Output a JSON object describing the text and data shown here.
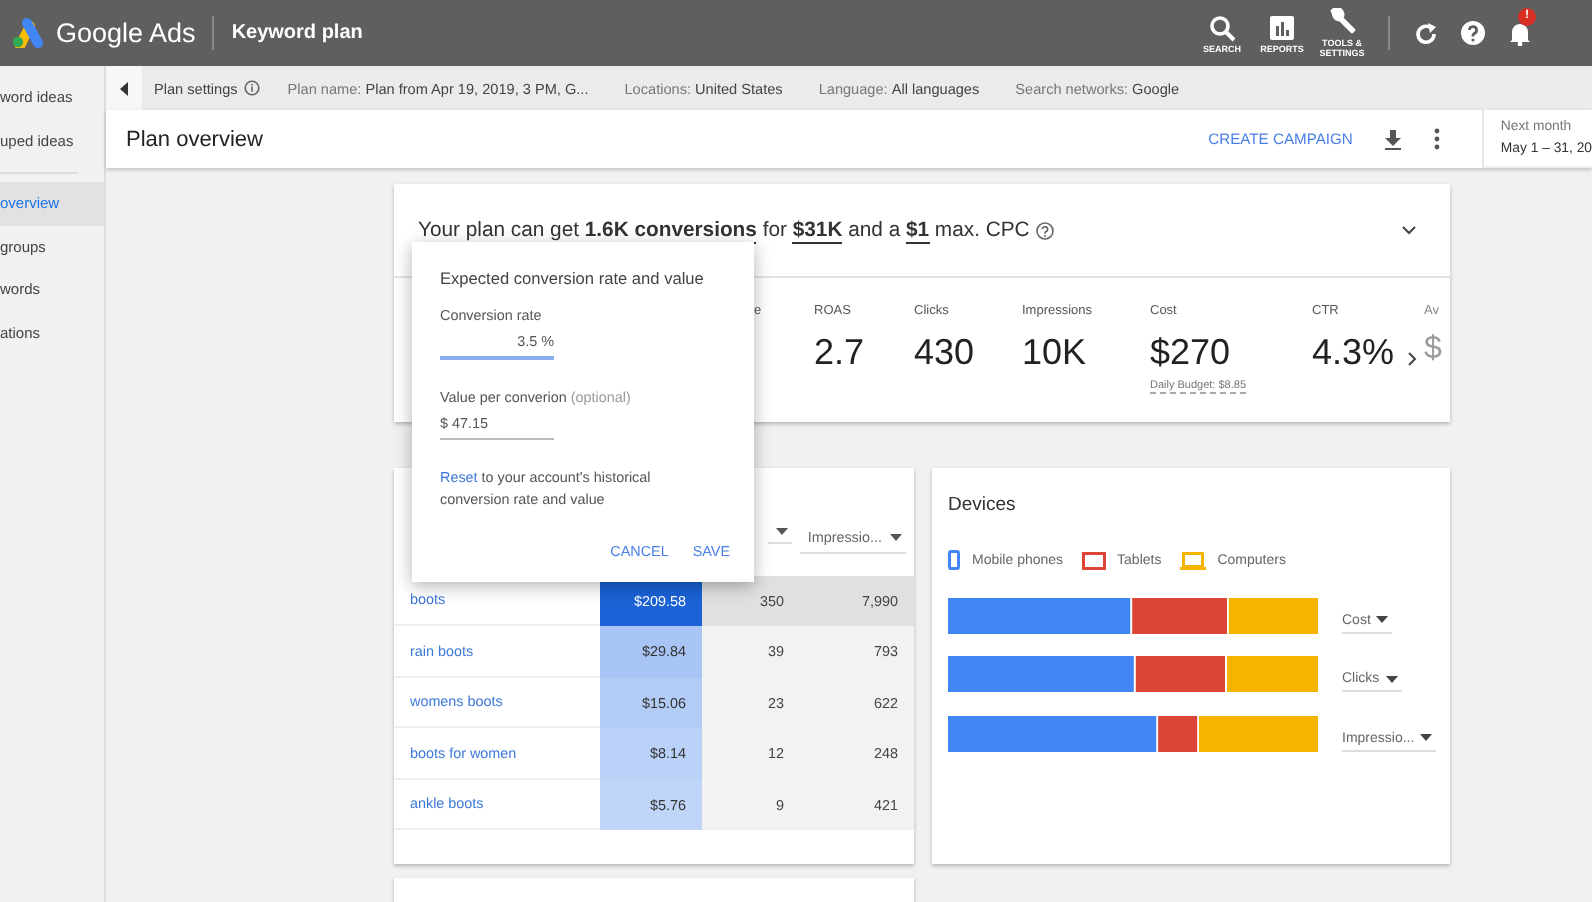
{
  "app_bar": {
    "product": "Google Ads",
    "page_title": "Keyword plan",
    "tools": [
      {
        "kind": "search",
        "label": "SEARCH"
      },
      {
        "kind": "reports",
        "label": "REPORTS"
      },
      {
        "kind": "tools",
        "label": "TOOLS &\nSETTINGS"
      }
    ],
    "notification_badge": "!"
  },
  "sidebar": {
    "sections": [
      {
        "items": [
          {
            "label": "word ideas",
            "selected": false
          },
          {
            "label": "uped ideas",
            "selected": false
          }
        ]
      },
      {
        "items": [
          {
            "label": "overview",
            "selected": true
          },
          {
            "label": "groups",
            "selected": false
          },
          {
            "label": "words",
            "selected": false
          },
          {
            "label": "ations",
            "selected": false
          }
        ]
      }
    ]
  },
  "plan_settings": {
    "title": "Plan settings",
    "items": [
      {
        "label": "Plan name:",
        "value": "Plan from Apr 19, 2019, 3 PM, G..."
      },
      {
        "label": "Locations:",
        "value": "United States"
      },
      {
        "label": "Language:",
        "value": "All languages"
      },
      {
        "label": "Search networks:",
        "value": "Google"
      }
    ]
  },
  "header": {
    "title": "Plan overview",
    "action": "CREATE CAMPAIGN",
    "date_label": "Next month",
    "date_range": "May 1 – 31, 20"
  },
  "summary": {
    "headline": "Your plan can get **1.6K conversions** for **$31K** and a **$1** max. CPC",
    "metrics": [
      {
        "label": "e",
        "faded": false
      },
      {
        "label": "ROAS",
        "value": "2.7",
        "faded": false
      },
      {
        "label": "Clicks",
        "value": "430",
        "faded": false
      },
      {
        "label": "Impressions",
        "value": "10K",
        "faded": false
      },
      {
        "label": "Cost",
        "value": "$270",
        "note": "Daily Budget: $8.85",
        "faded": false
      },
      {
        "label": "CTR",
        "value": "4.3%",
        "faded": false
      },
      {
        "label": "Av",
        "value": "$",
        "faded": true
      }
    ]
  },
  "conversion_popup": {
    "title": "Expected conversion rate and value",
    "fields": [
      {
        "label": "Conversion rate",
        "value": "3.5 %",
        "focused": true
      },
      {
        "label": "Value per converion",
        "hint": "(optional)",
        "value": "$ 47.15",
        "focused": false
      }
    ],
    "reset_link": "Reset",
    "reset_text": "to your account's historical conversion rate and value",
    "buttons": [
      "CANCEL",
      "SAVE"
    ]
  },
  "keywords": {
    "header": [
      {
        "kind": "caret"
      },
      {
        "kind": "labeled",
        "label": "Impressio..."
      }
    ],
    "rows": [
      {
        "keyword": "boots",
        "cost": "$209.58",
        "color": "#1a62d6",
        "clicks": "350",
        "impressions": "7,990",
        "selected": true
      },
      {
        "keyword": "rain boots",
        "cost": "$29.84",
        "color": "#a8c5f5",
        "clicks": "39",
        "impressions": "793",
        "selected": false
      },
      {
        "keyword": "womens boots",
        "cost": "$15.06",
        "color": "#b2ccf6",
        "clicks": "23",
        "impressions": "622",
        "selected": false
      },
      {
        "keyword": "boots for women",
        "cost": "$8.14",
        "color": "#bad2f8",
        "clicks": "12",
        "impressions": "248",
        "selected": false
      },
      {
        "keyword": "ankle boots",
        "cost": "$5.76",
        "color": "#c0d6f9",
        "clicks": "9",
        "impressions": "421",
        "selected": false
      }
    ]
  },
  "devices": {
    "title": "Devices",
    "legend": [
      {
        "kind": "phone",
        "label": "Mobile phones",
        "color": "#4285f4"
      },
      {
        "kind": "tablet",
        "label": "Tablets",
        "color": "#db4437"
      },
      {
        "kind": "laptop",
        "label": "Computers",
        "color": "#f4b400"
      }
    ],
    "metrics": [
      "Cost",
      "Clicks",
      "Impressio..."
    ]
  }
}
